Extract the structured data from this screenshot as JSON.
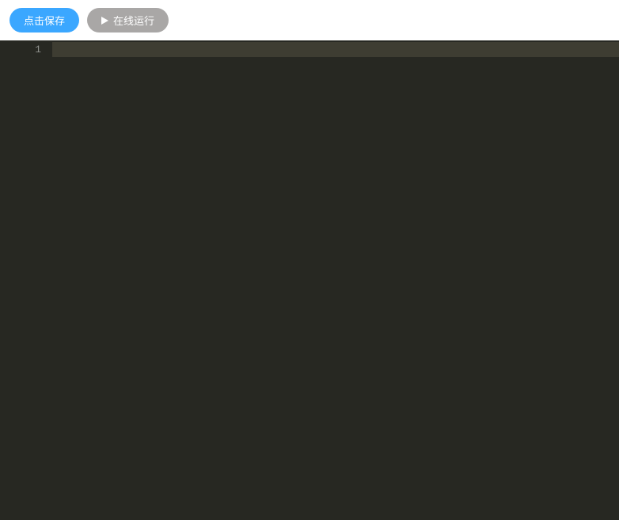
{
  "toolbar": {
    "save_label": "点击保存",
    "run_label": "在线运行"
  },
  "editor": {
    "line_numbers": [
      "1"
    ],
    "lines": [
      ""
    ]
  }
}
